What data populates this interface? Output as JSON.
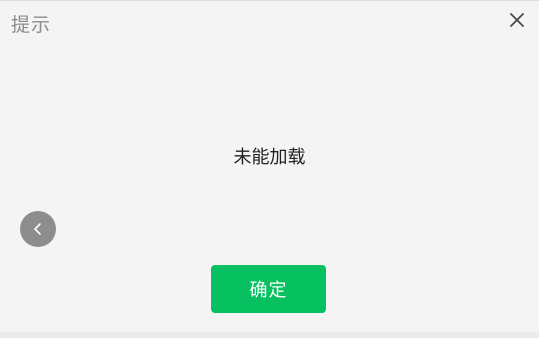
{
  "dialog": {
    "title": "提示",
    "close_icon": "close-icon",
    "message": "未能加载",
    "confirm_label": "确定",
    "back_icon": "chevron-left-icon"
  },
  "colors": {
    "background": "#f4f4f4",
    "title": "#8b8b8b",
    "message": "#222222",
    "confirm_bg": "#07c160",
    "confirm_text": "#ffffff",
    "back_bg": "#8d8d8d"
  }
}
